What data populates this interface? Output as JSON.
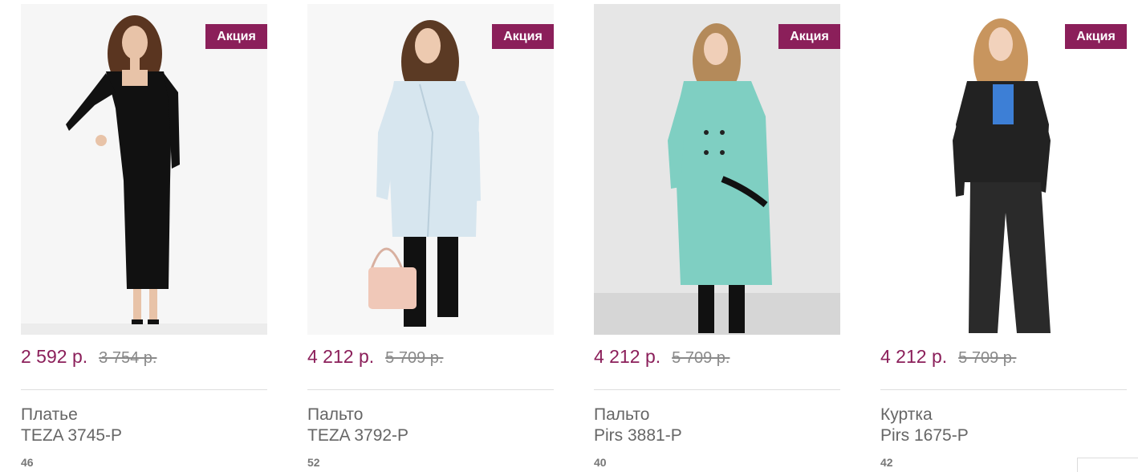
{
  "badge_color": "#8b1f5a",
  "products": [
    {
      "badge": "Акция",
      "price": "2 592 р.",
      "old_price": "3 754 р.",
      "name_line1": "Платье",
      "name_line2": "TEZA 3745-P",
      "size": "46",
      "image": "model-black-dress-photo"
    },
    {
      "badge": "Акция",
      "price": "4 212 р.",
      "old_price": "5 709 р.",
      "name_line1": "Пальто",
      "name_line2": "TEZA 3792-P",
      "size": "52",
      "image": "model-light-blue-coat-photo"
    },
    {
      "badge": "Акция",
      "price": "4 212 р.",
      "old_price": "5 709 р.",
      "name_line1": "Пальто",
      "name_line2": "Pirs 3881-P",
      "size": "40",
      "image": "model-mint-coat-photo"
    },
    {
      "badge": "Акция",
      "price": "4 212 р.",
      "old_price": "5 709 р.",
      "name_line1": "Куртка",
      "name_line2": "Pirs 1675-P",
      "size": "42",
      "image": "model-black-jacket-photo"
    }
  ]
}
